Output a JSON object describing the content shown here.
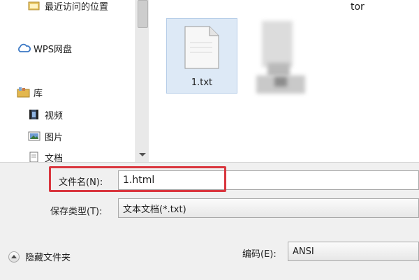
{
  "nav": {
    "recent": "最近访问的位置",
    "wps": "WPS网盘",
    "library": "库",
    "video": "视频",
    "pictures": "图片",
    "docs": "文档"
  },
  "files": {
    "partial_label": "tor",
    "items": [
      {
        "name": "1.txt",
        "icon": "text-file-icon"
      }
    ]
  },
  "filename": {
    "label": "文件名(N):",
    "value": "1.html"
  },
  "savetype": {
    "label": "保存类型(T):",
    "value": "文本文档(*.txt)"
  },
  "encoding": {
    "label": "编码(E):",
    "value": "ANSI"
  },
  "hide_folders": "隐藏文件夹",
  "colors": {
    "highlight": "#d9363e",
    "selection": "#dde9f6"
  }
}
